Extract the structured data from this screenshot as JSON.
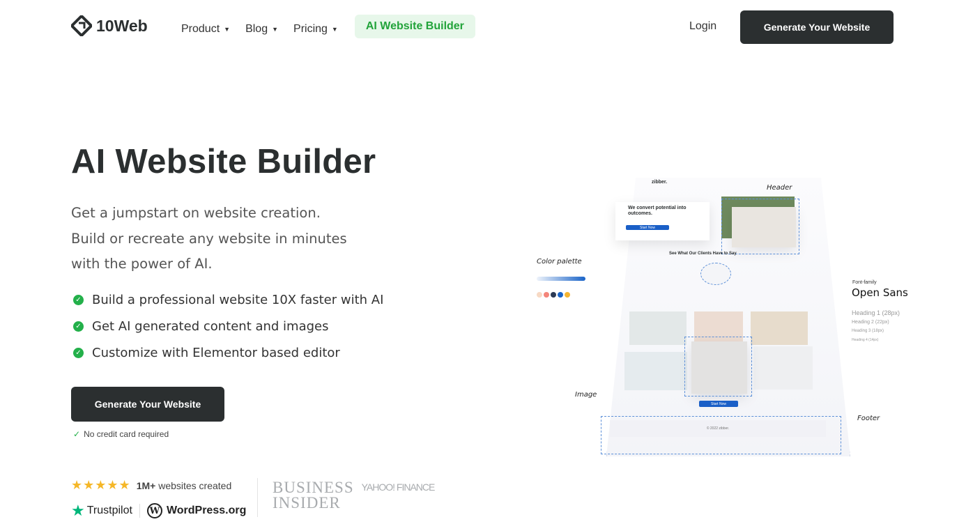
{
  "header": {
    "logo_text": "10Web",
    "nav": [
      {
        "label": "Product"
      },
      {
        "label": "Blog"
      },
      {
        "label": "Pricing"
      }
    ],
    "highlight": "AI Website Builder",
    "login": "Login",
    "cta": "Generate Your Website"
  },
  "hero": {
    "title": "AI Website Builder",
    "subtitle_lines": [
      "Get a jumpstart on website creation.",
      "Build or recreate any website in minutes",
      "with the power of AI."
    ],
    "bullets": [
      "Build a professional website 10X faster with AI",
      "Get AI generated content and images",
      "Customize with Elementor based editor"
    ],
    "cta": "Generate Your Website",
    "note": "No credit card required"
  },
  "social": {
    "stars": "★★★★★",
    "count": "1M+",
    "count_suffix": "websites created",
    "trustpilot": "Trustpilot",
    "wordpress": "WordPress.org",
    "press": [
      "BUSINESS INSIDER",
      "YAHOO! FINANCE"
    ]
  },
  "illustration": {
    "site_logo": "zibber.",
    "hero_heading": "We convert potential into outcomes.",
    "start_now": "Start Now",
    "testimonials_heading": "See What Our Clients Have to Say",
    "footer_text": "© 2022 zibber.",
    "labels": {
      "header": "Header",
      "color_palette": "Color palette",
      "image": "Image",
      "footer": "Footer",
      "font_family": "Font-family"
    },
    "font_name": "Open Sans",
    "headings": [
      "Heading 1 (28px)",
      "Heading 2 (22px)",
      "Heading 3 (18px)",
      "Heading 4 (14px)"
    ],
    "palette": [
      "#f7d9c4",
      "#f4857a",
      "#2b3a55",
      "#1a64c8",
      "#f5b532"
    ]
  },
  "colors": {
    "accent_green": "#22a33a",
    "dark": "#2b2f30"
  }
}
